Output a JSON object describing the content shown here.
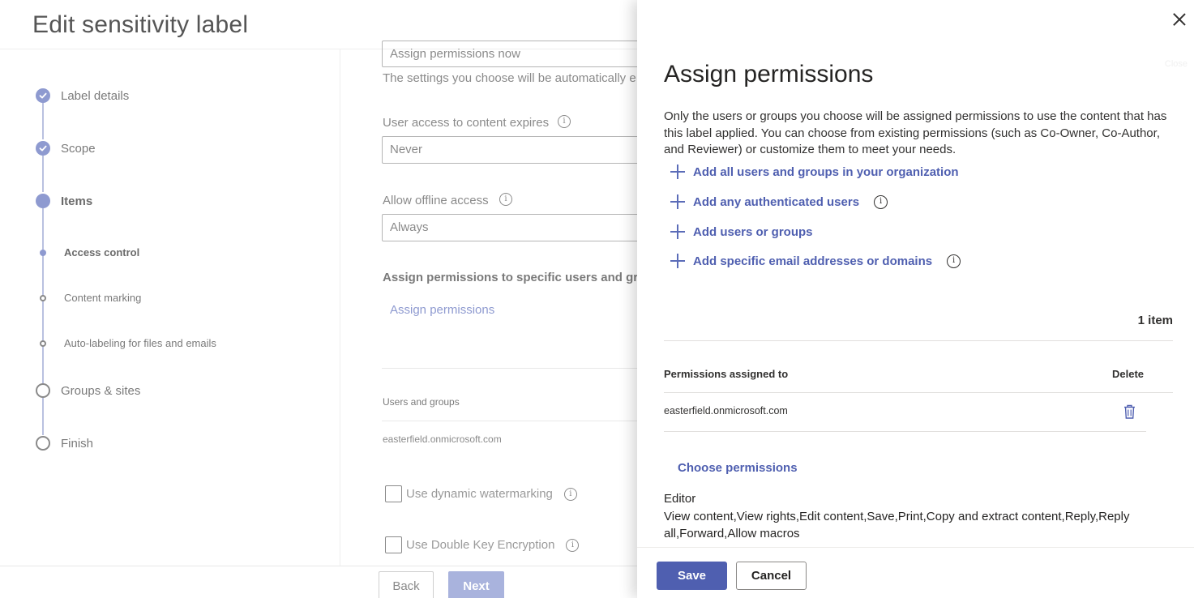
{
  "page": {
    "title": "Edit sensitivity label"
  },
  "stepper": {
    "steps": [
      {
        "label": "Label details",
        "state": "done"
      },
      {
        "label": "Scope",
        "state": "done"
      },
      {
        "label": "Items",
        "state": "current"
      },
      {
        "label": "Access control",
        "state": "sub-current"
      },
      {
        "label": "Content marking",
        "state": "sub-todo"
      },
      {
        "label": "Auto-labeling for files and emails",
        "state": "sub-todo"
      },
      {
        "label": "Groups & sites",
        "state": "todo"
      },
      {
        "label": "Finish",
        "state": "todo"
      }
    ]
  },
  "form": {
    "assign_mode_value": "Assign permissions now",
    "settings_note": "The settings you choose will be automatically e",
    "expires_label": "User access to content expires",
    "expires_value": "Never",
    "offline_label": "Allow offline access",
    "offline_value": "Always",
    "specific_heading": "Assign permissions to specific users and gro",
    "assign_link": "Assign permissions",
    "users_groups_header": "Users and groups",
    "users_groups_row": "easterfield.onmicrosoft.com",
    "dynamic_watermark_label": "Use dynamic watermarking",
    "dke_label": "Use Double Key Encryption",
    "back_label": "Back",
    "next_label": "Next"
  },
  "panel": {
    "close_hint": "Close",
    "title": "Assign permissions",
    "description": "Only the users or groups you choose will be assigned permissions to use the content that has this label applied. You can choose from existing permissions (such as Co-Owner, Co-Author, and Reviewer) or customize them to meet your needs.",
    "actions": {
      "add_all": "Add all users and groups in your organization",
      "add_authenticated": "Add any authenticated users",
      "add_users_groups": "Add users or groups",
      "add_email_domains": "Add specific email addresses or domains"
    },
    "item_count": "1 item",
    "table": {
      "col_assigned": "Permissions assigned to",
      "col_delete": "Delete",
      "rows": [
        {
          "assigned_to": "easterfield.onmicrosoft.com"
        }
      ]
    },
    "choose_permissions": "Choose permissions",
    "permission_role": "Editor",
    "permission_rights": "View content,View rights,Edit content,Save,Print,Copy and extract content,Reply,Reply all,Forward,Allow macros",
    "save_label": "Save",
    "cancel_label": "Cancel"
  },
  "colors": {
    "accent": "#4f5fb0",
    "stepper_accent": "#8e9ad0"
  },
  "icons": {
    "close": "close-icon",
    "info": "info-icon",
    "add": "plus-icon",
    "delete": "trash-icon",
    "checkmark": "checkmark-icon"
  }
}
